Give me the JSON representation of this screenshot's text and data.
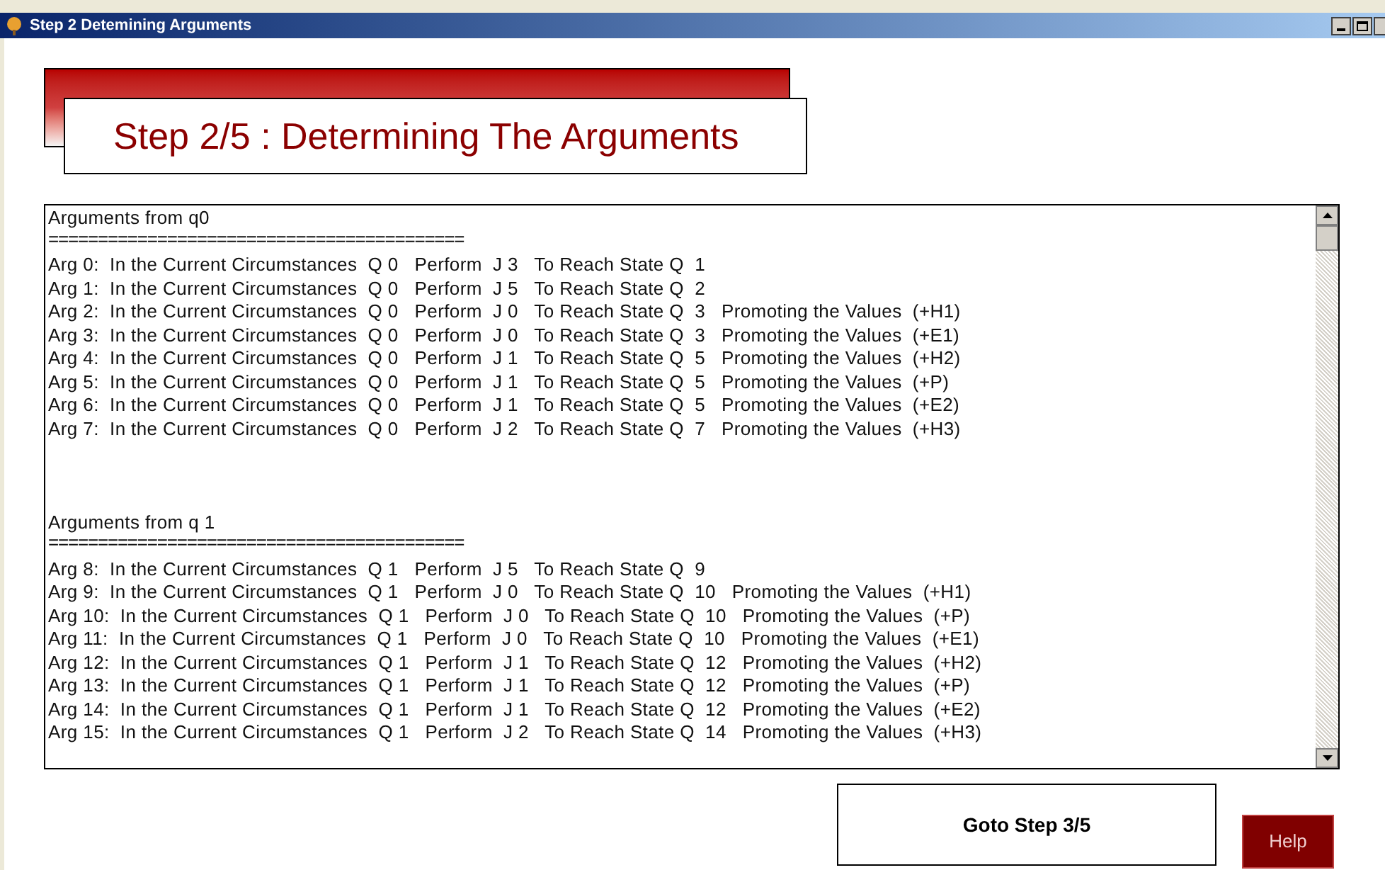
{
  "window": {
    "title": "Step 2 Detemining Arguments"
  },
  "heading": "Step 2/5 : Determining The Arguments",
  "sections": [
    {
      "title": "Arguments from q0",
      "rule": "==========================================",
      "lines": [
        "Arg 0:  In the Current Circumstances  Q 0   Perform  J 3   To Reach State Q  1",
        "Arg 1:  In the Current Circumstances  Q 0   Perform  J 5   To Reach State Q  2",
        "Arg 2:  In the Current Circumstances  Q 0   Perform  J 0   To Reach State Q  3   Promoting the Values  (+H1)",
        "Arg 3:  In the Current Circumstances  Q 0   Perform  J 0   To Reach State Q  3   Promoting the Values  (+E1)",
        "Arg 4:  In the Current Circumstances  Q 0   Perform  J 1   To Reach State Q  5   Promoting the Values  (+H2)",
        "Arg 5:  In the Current Circumstances  Q 0   Perform  J 1   To Reach State Q  5   Promoting the Values  (+P)",
        "Arg 6:  In the Current Circumstances  Q 0   Perform  J 1   To Reach State Q  5   Promoting the Values  (+E2)",
        "Arg 7:  In the Current Circumstances  Q 0   Perform  J 2   To Reach State Q  7   Promoting the Values  (+H3)"
      ]
    },
    {
      "title": "Arguments from q 1",
      "rule": "==========================================",
      "lines": [
        "Arg 8:  In the Current Circumstances  Q 1   Perform  J 5   To Reach State Q  9",
        "Arg 9:  In the Current Circumstances  Q 1   Perform  J 0   To Reach State Q  10   Promoting the Values  (+H1)",
        "Arg 10:  In the Current Circumstances  Q 1   Perform  J 0   To Reach State Q  10   Promoting the Values  (+P)",
        "Arg 11:  In the Current Circumstances  Q 1   Perform  J 0   To Reach State Q  10   Promoting the Values  (+E1)",
        "Arg 12:  In the Current Circumstances  Q 1   Perform  J 1   To Reach State Q  12   Promoting the Values  (+H2)",
        "Arg 13:  In the Current Circumstances  Q 1   Perform  J 1   To Reach State Q  12   Promoting the Values  (+P)",
        "Arg 14:  In the Current Circumstances  Q 1   Perform  J 1   To Reach State Q  12   Promoting the Values  (+E2)",
        "Arg 15:  In the Current Circumstances  Q 1   Perform  J 2   To Reach State Q  14   Promoting the Values  (+H3)"
      ]
    }
  ],
  "buttons": {
    "next": "Goto Step 3/5",
    "help": "Help"
  }
}
